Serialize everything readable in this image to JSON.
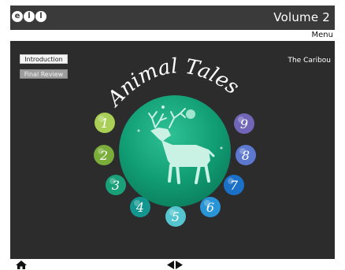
{
  "header": {
    "logo_letters": [
      "e",
      "l",
      "l"
    ],
    "volume": "Volume 2"
  },
  "menu_label": "Menu",
  "buttons": {
    "introduction": "Introduction",
    "final_review": "Final Review"
  },
  "title": "Animal Tales",
  "story_title": "The Caribou",
  "units": [
    "1",
    "2",
    "3",
    "4",
    "5",
    "6",
    "7",
    "8",
    "9"
  ],
  "colors": {
    "header_bg": "#3a3a3a",
    "stage_bg": "#2c2c2c",
    "globe": "#16a07a"
  },
  "footer": {
    "home": "home-icon",
    "nav": [
      "prev-arrow-icon",
      "next-arrow-icon"
    ]
  }
}
